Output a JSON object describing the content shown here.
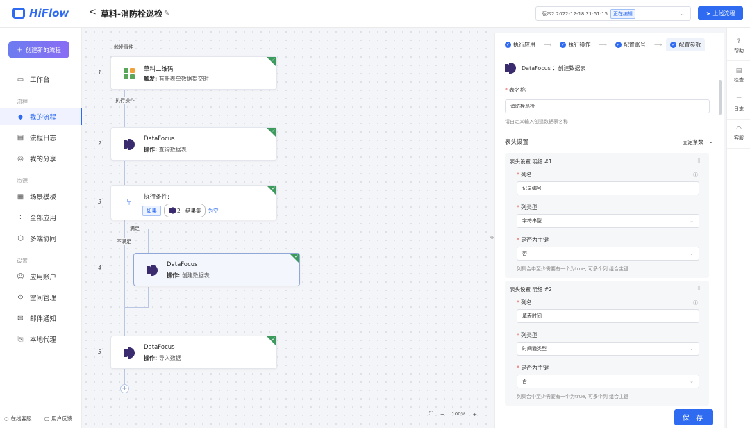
{
  "header": {
    "logo_text": "HiFlow",
    "back_label": "<",
    "flow_title": "草料-消防栓巡检",
    "version_text": "版本2  2022-12-18 21:51:15",
    "version_badge": "正在编辑",
    "publish_label": "上线流程"
  },
  "sidebar": {
    "new_flow_label": "创建新的流程",
    "workbench": "工作台",
    "section_flow": "流程",
    "my_flows": "我的流程",
    "flow_log": "流程日志",
    "my_share": "我的分享",
    "section_resource": "资源",
    "templates": "场景模板",
    "all_apps": "全部应用",
    "multi_sync": "多端协同",
    "section_settings": "设置",
    "app_accounts": "应用账户",
    "space_mgmt": "空间管理",
    "mail_notify": "邮件通知",
    "local_proxy": "本地代理",
    "online_support": "在线客服",
    "feedback": "用户反馈"
  },
  "canvas": {
    "trigger_label": "触发事件",
    "exec_label": "执行操作",
    "satisfied_label": "满足",
    "not_satisfied_label": "不满足",
    "zoom_level": "100%",
    "steps": [
      {
        "num": "1",
        "title": "草料二维码",
        "sub_key": "触发:",
        "sub_val": "有新表单数据提交时"
      },
      {
        "num": "2",
        "title": "DataFocus",
        "sub_key": "操作:",
        "sub_val": "查询数据表"
      },
      {
        "num": "3",
        "title": "执行条件:",
        "if_label": "如果",
        "set_label": "2 | 结果集",
        "empty_label": "为空"
      },
      {
        "num": "4",
        "title": "DataFocus",
        "sub_key": "操作:",
        "sub_val": "创建数据表"
      },
      {
        "num": "5",
        "title": "DataFocus",
        "sub_key": "操作:",
        "sub_val": "导入数据"
      }
    ]
  },
  "panel": {
    "tabs": [
      "执行应用",
      "执行操作",
      "配置账号",
      "配置参数"
    ],
    "app_title": "DataFocus ：创建数据表",
    "table_name_label": "表名称",
    "table_name_value": "消防栓巡检",
    "table_name_hint": "请自定义输入创建数据表名称",
    "header_settings": "表头设置",
    "fixed_count": "固定条数",
    "groups": [
      {
        "title": "表头设置 明细 #1",
        "col_name_label": "列名",
        "col_name_value": "记录编号",
        "col_type_label": "列类型",
        "col_type_value": "字符串型",
        "pk_label": "是否为主键",
        "pk_value": "否",
        "pk_hint": "列集合中至少需要有一个为true, 可多个列 组合主键"
      },
      {
        "title": "表头设置 明细 #2",
        "col_name_label": "列名",
        "col_name_value": "填表时间",
        "col_type_label": "列类型",
        "col_type_value": "时间戳类型",
        "pk_label": "是否为主键",
        "pk_value": "否",
        "pk_hint": "列集合中至少需要有一个为true, 可多个列 组合主键"
      }
    ],
    "save_label": "保 存"
  },
  "rightbar": {
    "help": "帮助",
    "check": "检查",
    "log": "日志",
    "support": "客服"
  },
  "colors": {
    "primary": "#2e6bf0",
    "success_corner": "#3b9a5c",
    "datafocus_brand": "#3a2a6e"
  }
}
